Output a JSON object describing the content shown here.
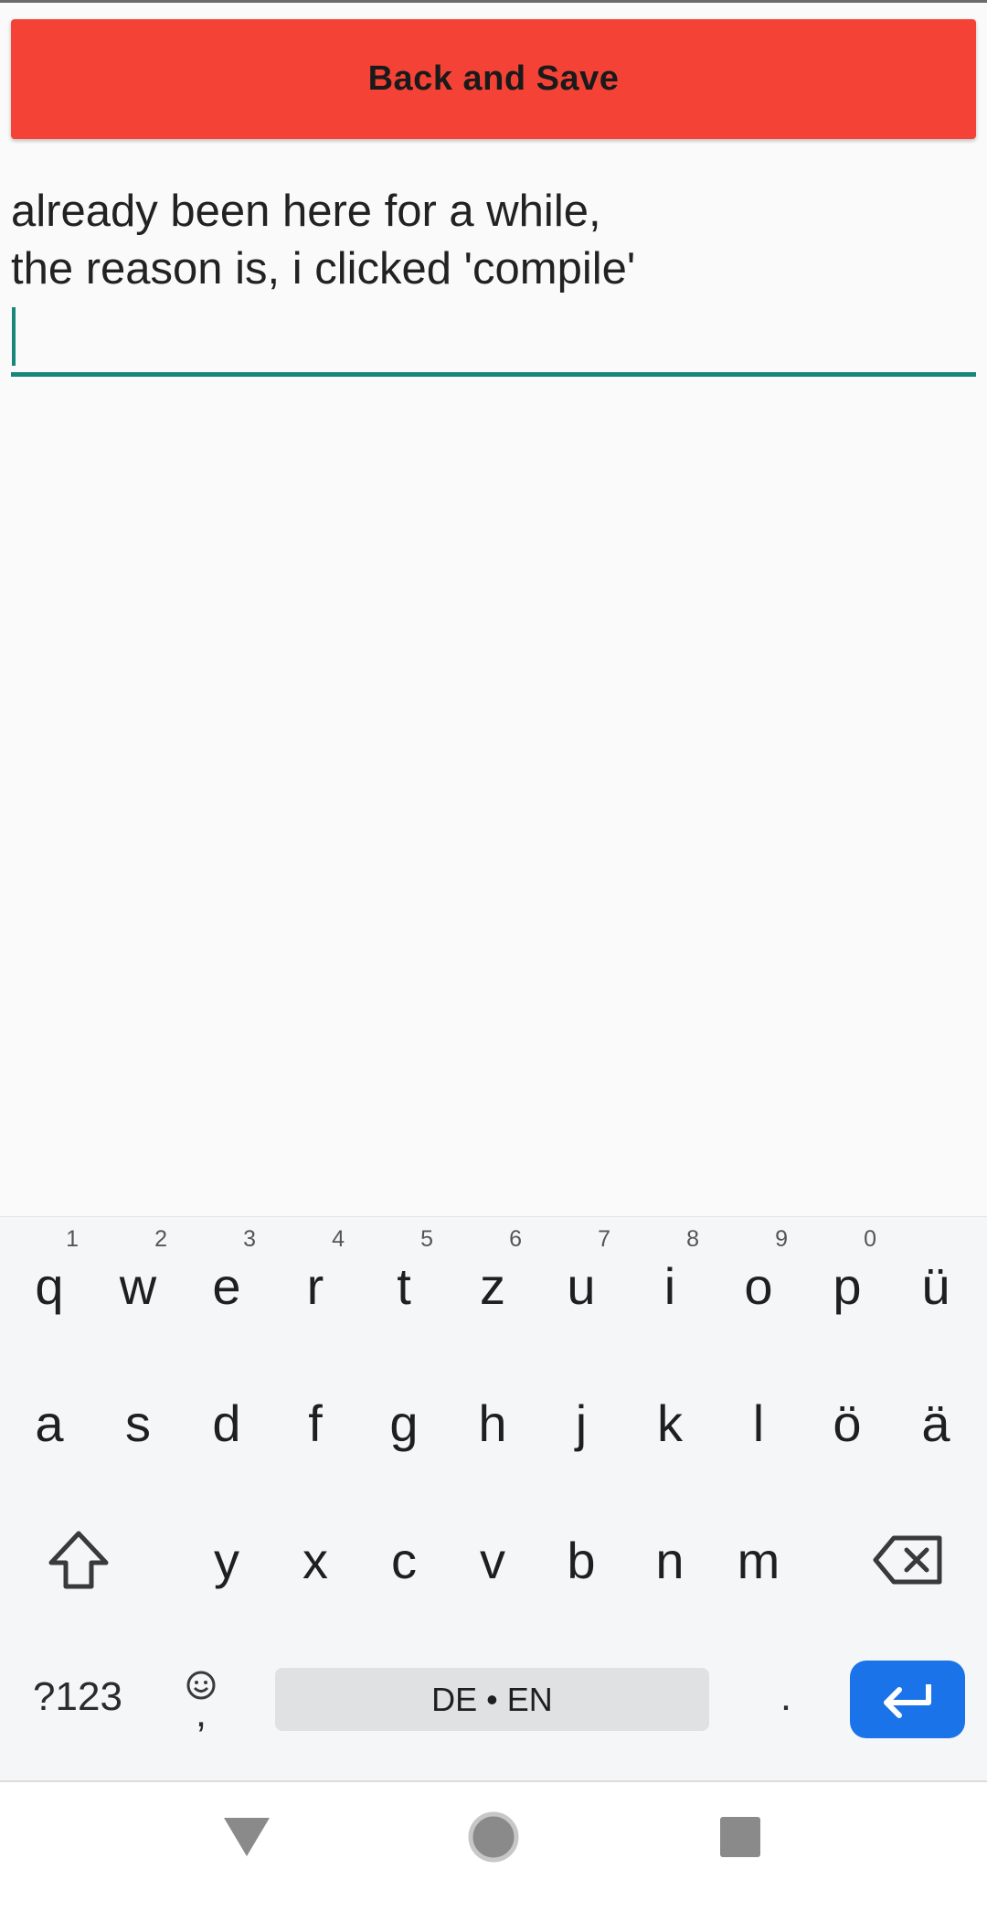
{
  "toolbar": {
    "save_label": "Back and Save"
  },
  "editor": {
    "lines": [
      "already been here for a while,",
      "the reason is, i clicked 'compile'"
    ]
  },
  "keyboard": {
    "row1": [
      {
        "key": "q",
        "hint": "1"
      },
      {
        "key": "w",
        "hint": "2"
      },
      {
        "key": "e",
        "hint": "3"
      },
      {
        "key": "r",
        "hint": "4"
      },
      {
        "key": "t",
        "hint": "5"
      },
      {
        "key": "z",
        "hint": "6"
      },
      {
        "key": "u",
        "hint": "7"
      },
      {
        "key": "i",
        "hint": "8"
      },
      {
        "key": "o",
        "hint": "9"
      },
      {
        "key": "p",
        "hint": "0"
      },
      {
        "key": "ü",
        "hint": ""
      }
    ],
    "row2": [
      "a",
      "s",
      "d",
      "f",
      "g",
      "h",
      "j",
      "k",
      "l",
      "ö",
      "ä"
    ],
    "row3": [
      "y",
      "x",
      "c",
      "v",
      "b",
      "n",
      "m"
    ],
    "symbols_label": "?123",
    "comma_label": ",",
    "space_label": "DE • EN",
    "period_label": ".",
    "shift_icon": "shift-icon",
    "backspace_icon": "backspace-icon",
    "enter_icon": "enter-icon",
    "emoji_icon": "emoji-icon"
  },
  "navbar": {
    "back_icon": "back-triangle-icon",
    "home_icon": "home-circle-icon",
    "recents_icon": "recents-square-icon"
  },
  "colors": {
    "accent": "#16877a",
    "save_button": "#f44336",
    "enter_key": "#1a73e8"
  }
}
